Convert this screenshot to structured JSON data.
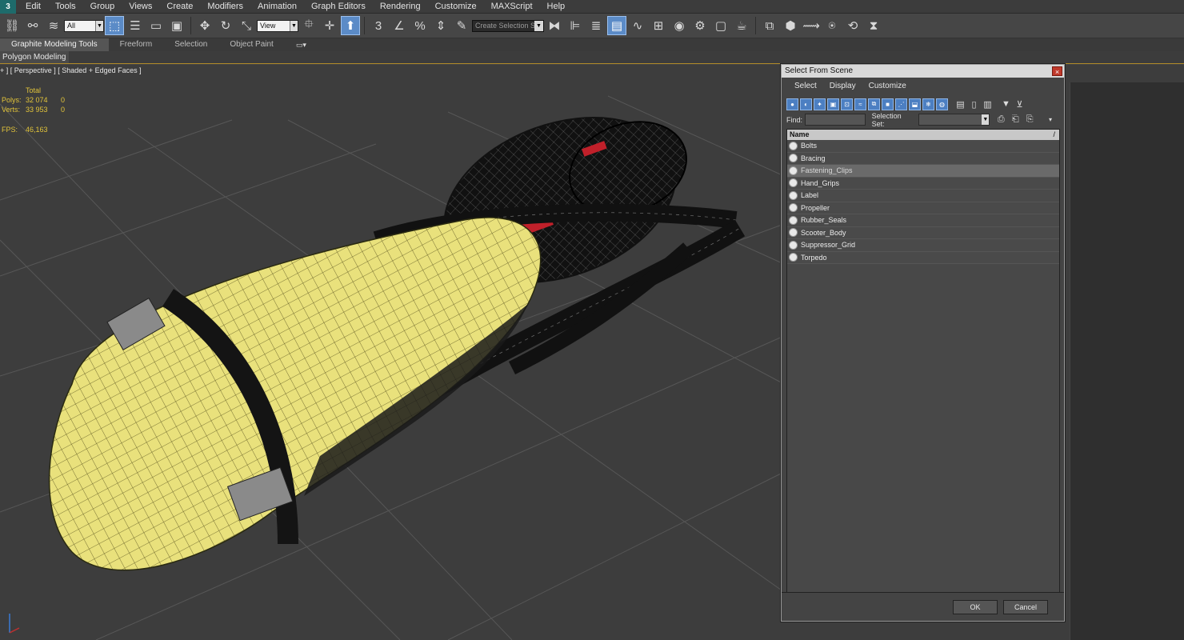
{
  "menubar": {
    "logo": "3",
    "items": [
      "Edit",
      "Tools",
      "Group",
      "Views",
      "Create",
      "Modifiers",
      "Animation",
      "Graph Editors",
      "Rendering",
      "Customize",
      "MAXScript",
      "Help"
    ]
  },
  "toolbar": {
    "filter_value": "All",
    "reference_coord": "View",
    "selection_set_placeholder": "Create Selection Se",
    "snap_label": "3"
  },
  "ribbon": {
    "tabs": [
      "Graphite Modeling Tools",
      "Freeform",
      "Selection",
      "Object Paint"
    ],
    "active_tab": "Graphite Modeling Tools",
    "panel_label": "Polygon Modeling"
  },
  "viewport": {
    "label": "+ ] [ Perspective ] [ Shaded + Edged Faces ]",
    "stats": {
      "header": "Total",
      "polys_label": "Polys:",
      "polys_value": "32 074",
      "polys_selected": "0",
      "verts_label": "Verts:",
      "verts_value": "33 953",
      "verts_selected": "0",
      "fps_label": "FPS:",
      "fps_value": "46,163"
    },
    "colors": {
      "body": "#e9e17c",
      "wire": "#111111",
      "background": "#3d3d3d",
      "grid": "#5a5a5a",
      "accent": "#c0202a"
    }
  },
  "dialog": {
    "title": "Select From Scene",
    "close_label": "×",
    "menu": [
      "Select",
      "Display",
      "Customize"
    ],
    "find_label": "Find:",
    "find_value": "",
    "selection_set_label": "Selection Set:",
    "selection_set_value": "",
    "column_header": "Name",
    "sort_indicator": "/",
    "objects": [
      "Bolts",
      "Bracing",
      "Fastening_Clips",
      "Hand_Grips",
      "Label",
      "Propeller",
      "Rubber_Seals",
      "Scooter_Body",
      "Suppressor_Grid",
      "Torpedo"
    ],
    "selected_object": "Fastening_Clips",
    "ok_label": "OK",
    "cancel_label": "Cancel"
  }
}
